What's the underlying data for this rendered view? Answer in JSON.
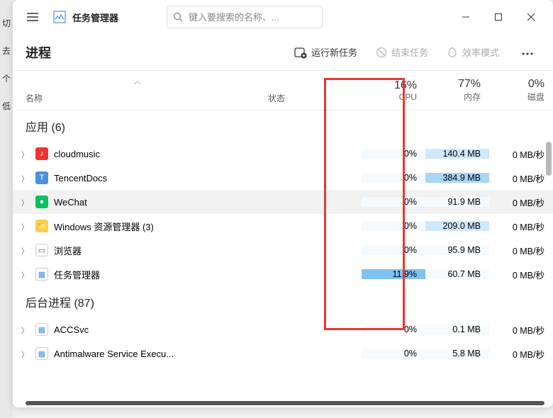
{
  "left_sliver": [
    "切",
    "去",
    "个",
    "低"
  ],
  "app": {
    "title": "任务管理器"
  },
  "search": {
    "placeholder": "键入要搜索的名称、..."
  },
  "toolbar": {
    "title": "进程",
    "run_new": "运行新任务",
    "end_task": "结束任务",
    "efficiency": "效率模式"
  },
  "columns": {
    "name": "名称",
    "status": "状态",
    "cpu": {
      "pct": "16%",
      "label": "CPU"
    },
    "mem": {
      "pct": "77%",
      "label": "内存"
    },
    "disk": {
      "pct": "0%",
      "label": "磁盘"
    }
  },
  "groups": {
    "apps": {
      "label": "应用 (6)"
    },
    "bg": {
      "label": "后台进程 (87)"
    }
  },
  "rows": [
    {
      "name": "cloudmusic",
      "cpu": "0%",
      "mem": "140.4 MB",
      "disk": "0 MB/秒",
      "icon_bg": "#e33",
      "icon_fg": "#fff",
      "icon_txt": "♪"
    },
    {
      "name": "TencentDocs",
      "cpu": "0%",
      "mem": "384.9 MB",
      "disk": "0 MB/秒",
      "icon_bg": "#4a90e2",
      "icon_fg": "#fff",
      "icon_txt": "T"
    },
    {
      "name": "WeChat",
      "cpu": "0%",
      "mem": "91.9 MB",
      "disk": "0 MB/秒",
      "icon_bg": "#07c160",
      "icon_fg": "#fff",
      "icon_txt": "●"
    },
    {
      "name": "Windows 资源管理器 (3)",
      "cpu": "0%",
      "mem": "209.0 MB",
      "disk": "0 MB/秒",
      "icon_bg": "#ffcc4d",
      "icon_fg": "#333",
      "icon_txt": "📁"
    },
    {
      "name": "浏览器",
      "cpu": "0%",
      "mem": "95.9 MB",
      "disk": "0 MB/秒",
      "icon_bg": "#fff",
      "icon_fg": "#555",
      "icon_txt": "▭"
    },
    {
      "name": "任务管理器",
      "cpu": "11.9%",
      "mem": "60.7 MB",
      "disk": "0 MB/秒",
      "icon_bg": "#fff",
      "icon_fg": "#4a90e2",
      "icon_txt": "▦"
    }
  ],
  "bg_rows": [
    {
      "name": "ACCSvc",
      "cpu": "0%",
      "mem": "0.1 MB",
      "disk": "0 MB/秒",
      "icon_bg": "#fff",
      "icon_fg": "#4a90e2",
      "icon_txt": "▦"
    },
    {
      "name": "Antimalware Service Execu...",
      "cpu": "0%",
      "mem": "5.8 MB",
      "disk": "0 MB/秒",
      "icon_bg": "#fff",
      "icon_fg": "#4a90e2",
      "icon_txt": "▦"
    }
  ]
}
